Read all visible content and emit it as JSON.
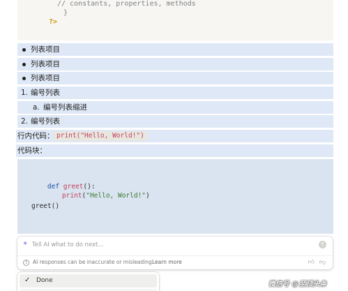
{
  "code_top": {
    "line1": "// constants, properties, methods",
    "line2": "}",
    "line3": "?>"
  },
  "list": {
    "bullets": [
      "列表项目",
      "列表项目",
      "列表项目"
    ],
    "numbered": [
      {
        "num": "1.",
        "label": "编号列表"
      },
      {
        "num": "a.",
        "label": "编号列表缩进"
      },
      {
        "num": "2.",
        "label": "编号列表"
      }
    ]
  },
  "inline": {
    "label": "行内代码：",
    "code": "print(\"Hello, World!\")"
  },
  "code_block": {
    "label": "代码块：",
    "line1_kw": "def",
    "line1_fn": "greet",
    "line1_rest": "():",
    "line2_fn": "print",
    "line2_open": "(",
    "line2_str": "\"Hello, World!\"",
    "line2_close": ")",
    "line3": "greet()"
  },
  "ai": {
    "placeholder": "Tell AI what to do next...",
    "note": "AI responses can be inaccurate or misleading.",
    "learn_more": "Learn more",
    "icons": {
      "spark": "sparkle-icon",
      "send": "send-arrow-icon",
      "warn": "info-icon",
      "up": "thumbs-up-icon",
      "down": "thumbs-down-icon"
    }
  },
  "menu": {
    "done_label": "Done"
  },
  "watermark": "微信号 @至顶头条",
  "colors": {
    "highlight": "#dfe8f6",
    "code_bg": "#dae3f0",
    "keyword": "#1a4fa3",
    "function": "#c2425a",
    "string": "#3a7a2e"
  }
}
